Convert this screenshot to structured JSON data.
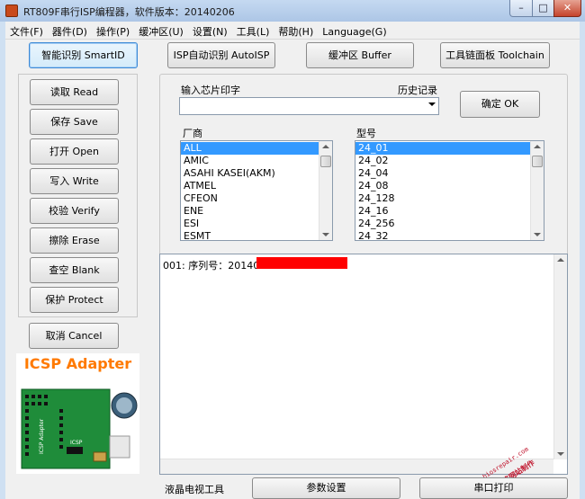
{
  "window": {
    "title": "RT809F串行ISP编程器，软件版本：20140206",
    "minimize": "–",
    "maximize": "□",
    "close": "✕"
  },
  "menu": [
    "文件(F)",
    "器件(D)",
    "操作(P)",
    "缓冲区(U)",
    "设置(N)",
    "工具(L)",
    "帮助(H)",
    "Language(G)"
  ],
  "toolbar": {
    "smartid": "智能识别 SmartID",
    "autoisp": "ISP自动识别 AutoISP",
    "buffer": "缓冲区 Buffer",
    "toolchain": "工具链面板 Toolchain"
  },
  "ops": {
    "read": "读取 Read",
    "save": "保存 Save",
    "open": "打开 Open",
    "write": "写入 Write",
    "verify": "校验 Verify",
    "erase": "擦除 Erase",
    "blank": "查空 Blank",
    "protect": "保护 Protect",
    "cancel": "取消 Cancel"
  },
  "chip": {
    "input_label": "输入芯片印字",
    "history_label": "历史记录",
    "input_value": "",
    "ok": "确定 OK"
  },
  "vendor": {
    "label": "厂商",
    "items": [
      "ALL",
      "AMIC",
      "ASAHI KASEI(AKM)",
      "ATMEL",
      "CFEON",
      "ENE",
      "ESI",
      "ESMT"
    ],
    "selected": 0
  },
  "model": {
    "label": "型号",
    "items": [
      "24_01",
      "24_02",
      "24_04",
      "24_08",
      "24_128",
      "24_16",
      "24_256",
      "24_32"
    ],
    "selected": 0
  },
  "log": {
    "line1": "001: 序列号：20140"
  },
  "adapter": {
    "title": "ICSP Adapter",
    "board_label": "ICSP Adapter",
    "chip_label": "ICSP"
  },
  "watermark": {
    "text": "www.biosrepair.com",
    "brand": "BIOS维修网站制作"
  },
  "bottom": {
    "lcd_tool": "液晶电视工具",
    "param": "参数设置",
    "serial": "串口打印"
  },
  "colors": {
    "selection": "#3399ff",
    "redaction": "#ff0000",
    "adapter_title": "#ff7a00",
    "pcb": "#1f8c3a",
    "watermark": "#c0142c"
  }
}
